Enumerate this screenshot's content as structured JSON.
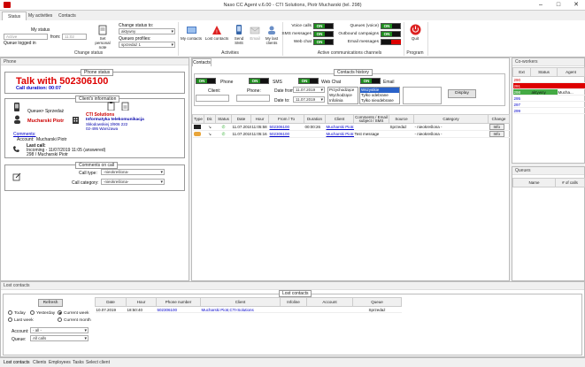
{
  "app": {
    "title": "Naso CC Agent v.6.00 - CTI Solutions, Piotr Mucharski (tel. 298)"
  },
  "tabs": [
    "Status",
    "My activities",
    "Contacts"
  ],
  "ribbon": {
    "my_status_label": "My status",
    "status_value": "Active",
    "from_label": "from:",
    "from_value": "11:02",
    "queue_logged_label": "Queue logged in",
    "set_personal_note": "Set personal note",
    "change_status_to": "Change status to:",
    "status_combo": "aktywny",
    "queue_profiles": "Queues profiles:",
    "queue_profile_value": "sprzedaż 1",
    "change_status_group": "Change status",
    "my_contacts": "My contacts",
    "lost_contacts": "Lost contacts",
    "send_sms": "Send SMS",
    "email": "Email",
    "my_last_clients": "My last clients",
    "activities_group": "Activities",
    "voice_calls": "Voice calls",
    "sms_messages": "SMS messages",
    "web_chat": "Web chat",
    "queues_voice": "Queues (voice)",
    "outbound_campaigns": "Outbound campaigns",
    "email_messages": "Email messages",
    "on": "ON",
    "active_channels_group": "Active communications channels",
    "quit": "Quit",
    "program_group": "Program"
  },
  "phone": {
    "header": "Phone",
    "status_title": "Phone status",
    "talk": "Talk with 502306100",
    "duration": "Call duration: 00:07",
    "client_info_title": "Client's information",
    "queue_label": "Queue:",
    "queue_value": "-> Sprzedaż",
    "client_name": "Mucharski Piotr",
    "company": "CTI Solutions",
    "company_sub": "Informatyka telekomunikacja",
    "address1": "Skłodowskiej 3/906 222",
    "address2": "02-495 Warszawa",
    "comments": "Comments:",
    "account_label": "Account:",
    "account_value": "Mucharski Piotr",
    "last_call": "Last call:",
    "last_call_line1": "Incoming - 11/07/2019 11:05 (answered)",
    "last_call_line2": "298 / Mucharski Piotr",
    "comments_on_call_title": "Comments on call",
    "call_type_label": "Call type:",
    "call_type_value": "-nieokreślona-",
    "call_category_label": "Call category:",
    "call_category_value": "-nieokreślona-"
  },
  "contacts": {
    "header": "Contacts",
    "history_title": "Contacts history",
    "phone_lbl": "Phone",
    "sms_lbl": "SMS",
    "webchat_lbl": "Web Chat",
    "email_lbl": "Email",
    "client_lbl": "Client:",
    "phone_field_lbl": "Phone:",
    "date_from_lbl": "Date from:",
    "date_to_lbl": "Date to:",
    "date_from": "11.07.2019",
    "date_to": "11.07.2019",
    "dir_options": [
      "Przychodzące",
      "Wychodzące",
      "Infolinia"
    ],
    "status_options": [
      "Wszystkie",
      "Tylko odebrane",
      "Tylko nieodebrane"
    ],
    "display_btn": "Display",
    "columns": [
      "Type",
      "Dir.",
      "Status",
      "Date",
      "Hour",
      "From / To",
      "Duration",
      "Client",
      "Comments / Email subject / SMS",
      "Source",
      "Category",
      "Change"
    ],
    "rows": [
      {
        "date": "11.07.2019",
        "hour": "11:05:58",
        "from": "502306100",
        "duration": "00:00:26",
        "client": "Mucharski Piotr...",
        "comment": "",
        "source": "Sprzedaż",
        "category": "- nieokreślona -",
        "change": "Info"
      },
      {
        "date": "11.07.2019",
        "hour": "11:05:16",
        "from": "502306100",
        "duration": "",
        "client": "Mucharski Piotr...",
        "comment": "Test message",
        "source": "",
        "category": "- nieokreślona -",
        "change": "Info"
      }
    ]
  },
  "coworkers": {
    "header": "Co-workers",
    "columns": [
      "Ext",
      "Status",
      "Agent"
    ],
    "rows": [
      {
        "ext": "290",
        "status": "",
        "agent": ""
      },
      {
        "ext": "291",
        "status": "",
        "agent": ""
      },
      {
        "ext": "298",
        "status": "aktywny",
        "agent": "Mucha..."
      },
      {
        "ext": "295",
        "status": "",
        "agent": ""
      },
      {
        "ext": "297",
        "status": "",
        "agent": ""
      },
      {
        "ext": "299",
        "status": "",
        "agent": ""
      }
    ]
  },
  "queues": {
    "header": "Queues",
    "columns": [
      "Name",
      "# of calls"
    ]
  },
  "lost": {
    "header": "Lost contacts",
    "title": "Lost contacts",
    "refresh": "Refresh",
    "today": "Today",
    "yesterday": "Yesterday",
    "current_week": "Current week",
    "last_week": "Last week",
    "current_month": "Current month",
    "account_lbl": "Account:",
    "account_val": "- all -",
    "queue_lbl": "Queue:",
    "queue_val": "All calls",
    "columns": [
      "Date",
      "Hour",
      "Phone number",
      "Client",
      "Infoline",
      "Account",
      "Queue"
    ],
    "rows": [
      {
        "date": "10.07.2019",
        "hour": "18:50:40",
        "phone": "502306100",
        "client": "Mucharski Piotr,CTI-Solutions",
        "infoline": "",
        "account": "",
        "queue": "Sprzedaż"
      }
    ]
  },
  "bottom_tabs": [
    "Lost contacts",
    "Clients",
    "Employees",
    "Tasks",
    "Select client"
  ]
}
